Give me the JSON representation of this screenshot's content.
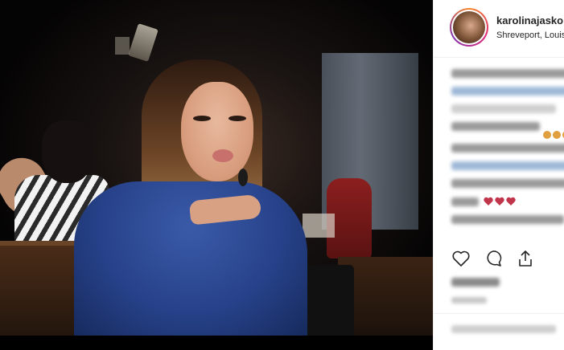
{
  "post": {
    "username": "karolinajasko",
    "location": "Shreveport, Louisiana"
  },
  "icons": {
    "like": "heart-outline-icon",
    "comment": "speech-bubble-icon",
    "share": "share-icon"
  },
  "colors": {
    "avatar_ring": "#dd2a7b",
    "sidebar_bg": "#ffffff",
    "text": "#262626"
  }
}
